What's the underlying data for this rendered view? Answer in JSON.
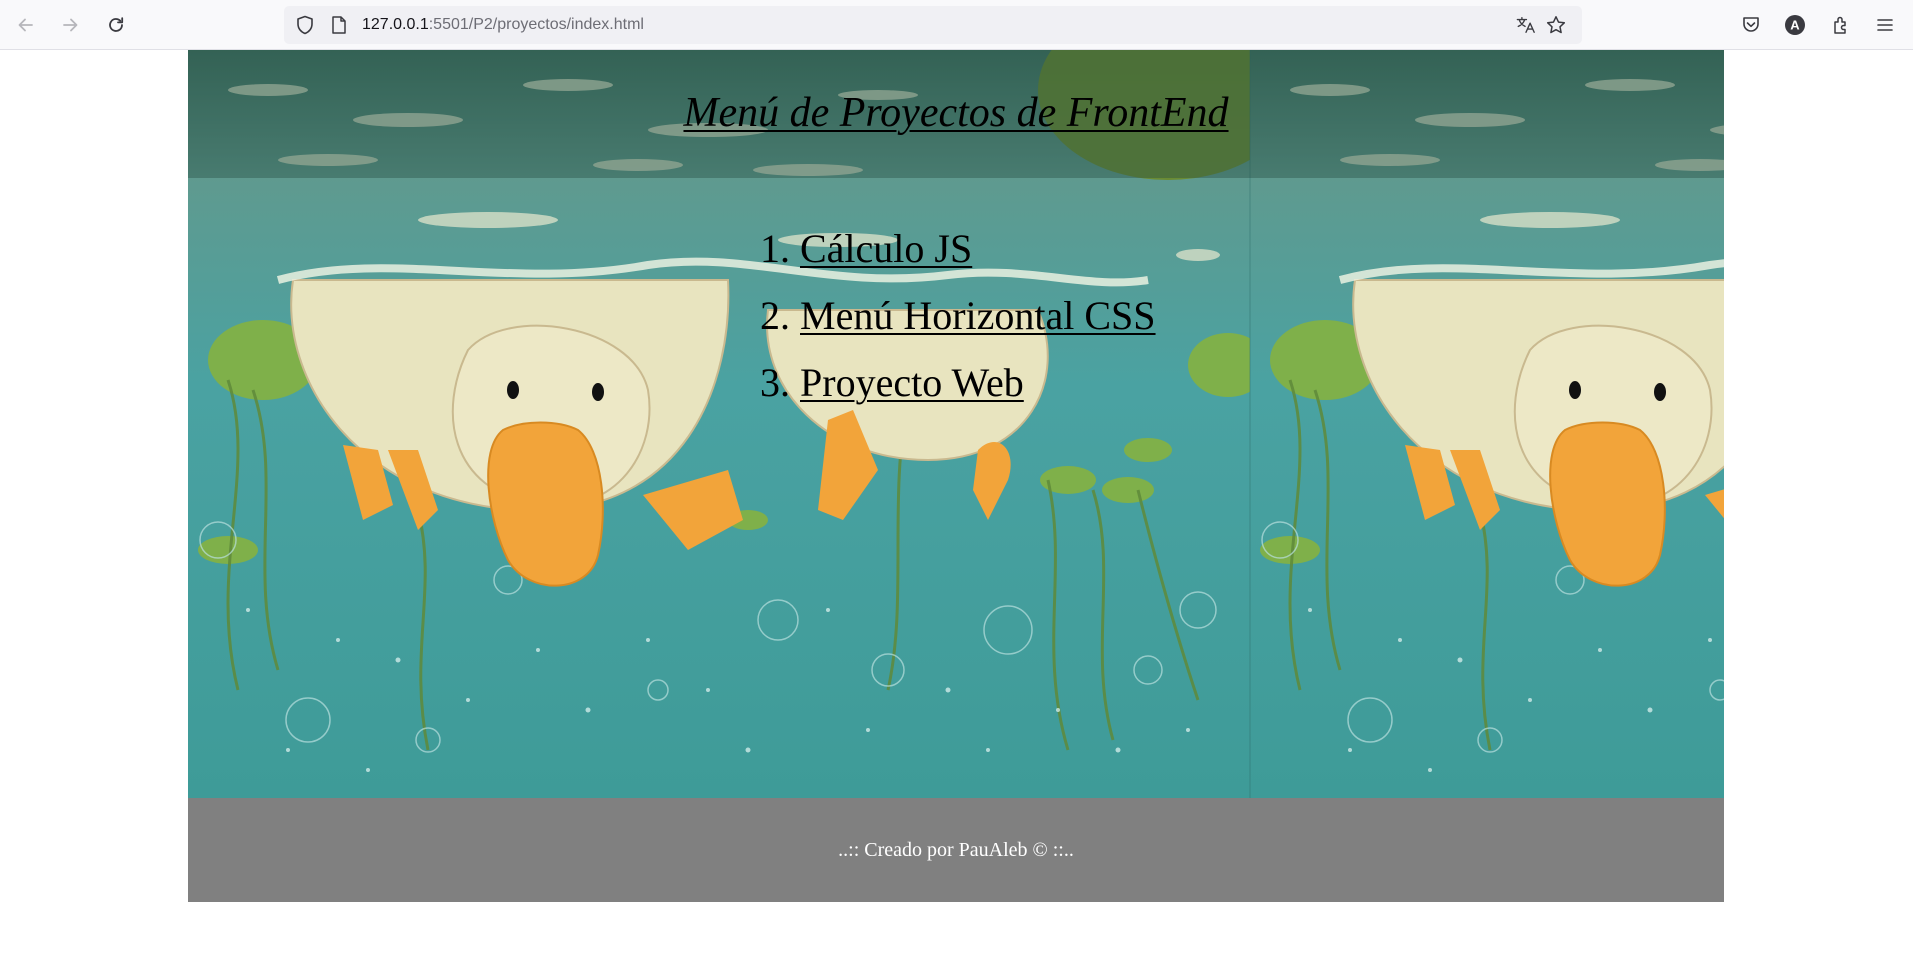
{
  "browser": {
    "url_host": "127.0.0.1",
    "url_path": ":5501/P2/proyectos/index.html",
    "icons": [
      "back-arrow-icon",
      "forward-arrow-icon",
      "reload-icon",
      "shield-icon",
      "page-icon",
      "translate-icon",
      "star-icon",
      "pocket-icon",
      "account-icon",
      "extensions-icon",
      "menu-icon"
    ]
  },
  "page": {
    "title": "Menú de Proyectos de FrontEnd",
    "projects": [
      {
        "number": "1.",
        "label": "Cálculo JS"
      },
      {
        "number": "2.",
        "label": "Menú Horizontal CSS"
      },
      {
        "number": "3.",
        "label": "Proyecto Web"
      }
    ],
    "footer": "..:: Creado por PauAleb © ::.."
  },
  "colors": {
    "footer_bg": "#808080",
    "water": "#3f9a98",
    "duck": "#e8e4bf",
    "beak": "#f2a43a"
  }
}
